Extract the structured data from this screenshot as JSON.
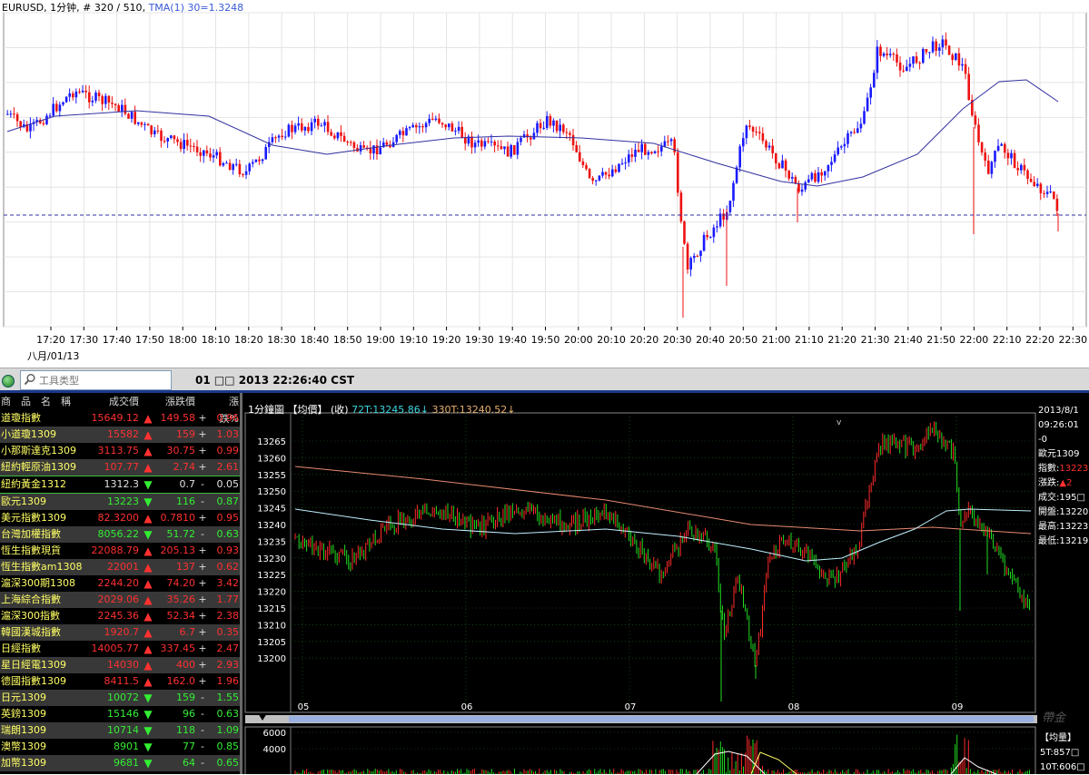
{
  "top_chart": {
    "symbol": "EURUSD",
    "timeframe": "1分钟",
    "bars_info": "# 320 / 510",
    "indicator": "TMA(1) 30=1.3248",
    "date_label": "八月/01/13",
    "x_ticks": [
      "17:20",
      "17:30",
      "17:40",
      "17:50",
      "18:00",
      "18:10",
      "18:20",
      "18:30",
      "18:40",
      "18:50",
      "19:00",
      "19:10",
      "19:20",
      "19:30",
      "19:40",
      "19:50",
      "20:00",
      "20:10",
      "20:20",
      "20:30",
      "20:40",
      "20:50",
      "21:00",
      "21:10",
      "21:20",
      "21:30",
      "21:40",
      "21:50",
      "22:00",
      "22:10",
      "22:20",
      "22:30"
    ],
    "colors": {
      "up": "#1a1aff",
      "down": "#ee1111",
      "tma": "#3030a0",
      "dashed": "#3030a0",
      "grid": "#e4e4e4"
    }
  },
  "toolbar": {
    "search_placeholder": "工具类型",
    "datetime": "01 □□ 2013 22:26:40 CST"
  },
  "quote_table": {
    "headers": [
      "商　品　名　稱",
      "成交價",
      "漲跌價",
      "漲跌%"
    ],
    "rows": [
      {
        "name": "道瓊指數",
        "price": "15649.12",
        "dir": "up",
        "chg": "149.58",
        "sign": "+",
        "pct": "0.96"
      },
      {
        "name": "小道瓊1309",
        "price": "15582",
        "dir": "up",
        "chg": "159",
        "sign": "+",
        "pct": "1.03"
      },
      {
        "name": "小那斯達克1309",
        "price": "3113.75",
        "dir": "up",
        "chg": "30.75",
        "sign": "+",
        "pct": "0.99"
      },
      {
        "name": "紐約輕原油1309",
        "price": "107.77",
        "dir": "up",
        "chg": "2.74",
        "sign": "+",
        "pct": "2.61"
      },
      {
        "name": "紐約黃金1312",
        "price": "1312.3",
        "dir": "dn",
        "chg": "0.7",
        "sign": "-",
        "pct": "0.05"
      },
      {
        "name": "歐元1309",
        "price": "13223",
        "dir": "dn",
        "chg": "116",
        "sign": "-",
        "pct": "0.87"
      },
      {
        "name": "美元指數1309",
        "price": "82.3200",
        "dir": "up",
        "chg": "0.7810",
        "sign": "+",
        "pct": "0.95"
      },
      {
        "name": "台灣加權指數",
        "price": "8056.22",
        "dir": "dn",
        "chg": "51.72",
        "sign": "-",
        "pct": "0.63"
      },
      {
        "name": "恆生指數現貨",
        "price": "22088.79",
        "dir": "up",
        "chg": "205.13",
        "sign": "+",
        "pct": "0.93"
      },
      {
        "name": "恆生指數am1308",
        "price": "22001",
        "dir": "up",
        "chg": "137",
        "sign": "+",
        "pct": "0.62"
      },
      {
        "name": "滬深300期1308",
        "price": "2244.20",
        "dir": "up",
        "chg": "74.20",
        "sign": "+",
        "pct": "3.42"
      },
      {
        "name": "上海綜合指數",
        "price": "2029.06",
        "dir": "up",
        "chg": "35.26",
        "sign": "+",
        "pct": "1.77"
      },
      {
        "name": "滬深300指數",
        "price": "2245.36",
        "dir": "up",
        "chg": "52.34",
        "sign": "+",
        "pct": "2.38"
      },
      {
        "name": "韓國漢城指數",
        "price": "1920.7",
        "dir": "up",
        "chg": "6.7",
        "sign": "+",
        "pct": "0.35"
      },
      {
        "name": "日經指數",
        "price": "14005.77",
        "dir": "up",
        "chg": "337.45",
        "sign": "+",
        "pct": "2.47"
      },
      {
        "name": "星日經電1309",
        "price": "14030",
        "dir": "up",
        "chg": "400",
        "sign": "+",
        "pct": "2.93"
      },
      {
        "name": "德國指數1309",
        "price": "8411.5",
        "dir": "up",
        "chg": "162.0",
        "sign": "+",
        "pct": "1.96"
      },
      {
        "name": "日元1309",
        "price": "10072",
        "dir": "dn",
        "chg": "159",
        "sign": "-",
        "pct": "1.55"
      },
      {
        "name": "英鎊1309",
        "price": "15146",
        "dir": "dn",
        "chg": "96",
        "sign": "-",
        "pct": "0.63"
      },
      {
        "name": "瑞朗1309",
        "price": "10714",
        "dir": "dn",
        "chg": "118",
        "sign": "-",
        "pct": "1.09"
      },
      {
        "name": "澳幣1309",
        "price": "8901",
        "dir": "dn",
        "chg": "77",
        "sign": "-",
        "pct": "0.85"
      },
      {
        "name": "加幣1309",
        "price": "9681",
        "dir": "dn",
        "chg": "64",
        "sign": "-",
        "pct": "0.65"
      }
    ]
  },
  "bottom_chart": {
    "period": "1分鐘圖",
    "mode": "【均價】",
    "close": "(收)",
    "ma1_label": "72T:13245.86↓",
    "ma2_label": "330T:13240.52↓",
    "y_ticks": [
      "13265",
      "13260",
      "13255",
      "13250",
      "13245",
      "13240",
      "13235",
      "13230",
      "13225",
      "13220",
      "13215",
      "13210",
      "13205",
      "13200"
    ],
    "x_ticks": [
      "05",
      "06",
      "07",
      "08",
      "09"
    ],
    "info": {
      "date": "2013/8/1",
      "time": "09:26:01",
      "time_suffix": "-0",
      "name": "歐元1309",
      "index_label": "指數:",
      "index_value": "13223",
      "change_label": "漲跌:",
      "change_value": "▲2",
      "volume": "成交:195□",
      "open": "開盤:13220",
      "high": "最高:13223",
      "low": "最低:13219"
    },
    "volume_panel": {
      "y_ticks": [
        "6000",
        "4000"
      ],
      "title": "【均量】",
      "ma1": "5T:857□",
      "ma2": "10T:606□"
    },
    "watermark": "帶金",
    "colors": {
      "up": "#ff2a2a",
      "down": "#22dd22",
      "ma1": "#bff0ff",
      "ma2": "#e88a70",
      "grid": "#1f6b1f"
    }
  }
}
